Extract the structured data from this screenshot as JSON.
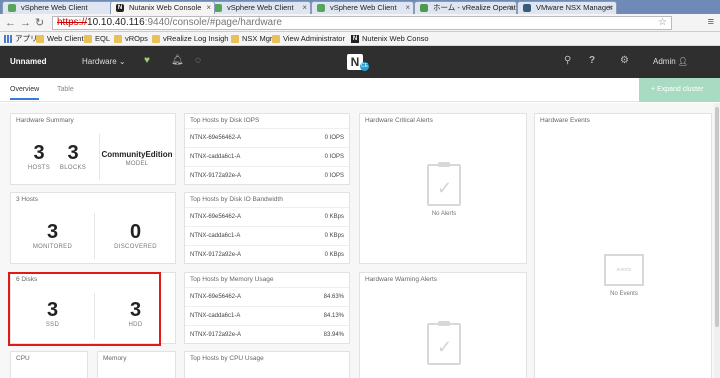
{
  "browser": {
    "tabs": [
      {
        "label": "vSphere Web Client",
        "icon": "vsphere-icon"
      },
      {
        "label": "Nutanix Web Console",
        "icon": "nutanix-icon"
      },
      {
        "label": "vSphere Web Client",
        "icon": "vsphere-icon"
      },
      {
        "label": "vSphere Web Client",
        "icon": "vsphere-icon"
      },
      {
        "label": "ホーム - vRealize Operat",
        "icon": "vrealize-icon"
      },
      {
        "label": "VMware NSX Manager",
        "icon": "vmware-icon"
      }
    ],
    "url_scheme": "https://",
    "url_host": "10.10.40.116",
    "url_path": ":9440/console/#page/hardware",
    "bookmarks": [
      "アプリ",
      "Web Client",
      "EQL",
      "vROps",
      "vRealize Log Insigh",
      "NSX Mgr",
      "View Administrator",
      "Nutenix Web Conso"
    ]
  },
  "header": {
    "cluster_name": "Unnamed",
    "menu": "Hardware",
    "logo_badge": "CE",
    "help": "?",
    "user": "Admin"
  },
  "subnav": {
    "tabs": [
      "Overview",
      "Table"
    ],
    "expand_button": "+ Expand cluster"
  },
  "hardware_summary": {
    "title": "Hardware Summary",
    "hosts_value": "3",
    "hosts_label": "HOSTS",
    "blocks_value": "3",
    "blocks_label": "BLOCKS",
    "model_value": "CommunityEdition",
    "model_label": "MODEL"
  },
  "hosts": {
    "title": "3 Hosts",
    "monitored_value": "3",
    "monitored_label": "MONITORED",
    "discovered_value": "0",
    "discovered_label": "DISCOVERED"
  },
  "disks": {
    "title": "6 Disks",
    "ssd_value": "3",
    "ssd_label": "SSD",
    "hdd_value": "3",
    "hdd_label": "HDD"
  },
  "cpu": {
    "title": "CPU"
  },
  "memory": {
    "title": "Memory"
  },
  "top_iops": {
    "title": "Top Hosts by Disk IOPS",
    "rows": [
      {
        "host": "NTNX-69e56462-A",
        "value": "0 IOPS"
      },
      {
        "host": "NTNX-cadda6c1-A",
        "value": "0 IOPS"
      },
      {
        "host": "NTNX-9172a92e-A",
        "value": "0 IOPS"
      }
    ]
  },
  "top_bw": {
    "title": "Top Hosts by Disk IO Bandwidth",
    "rows": [
      {
        "host": "NTNX-69e56462-A",
        "value": "0 KBps"
      },
      {
        "host": "NTNX-cadda6c1-A",
        "value": "0 KBps"
      },
      {
        "host": "NTNX-9172a92e-A",
        "value": "0 KBps"
      }
    ]
  },
  "top_mem": {
    "title": "Top Hosts by Memory Usage",
    "rows": [
      {
        "host": "NTNX-69e56462-A",
        "value": "84.63%"
      },
      {
        "host": "NTNX-cadda6c1-A",
        "value": "84.13%"
      },
      {
        "host": "NTNX-9172a92e-A",
        "value": "83.94%"
      }
    ]
  },
  "top_cpu": {
    "title": "Top Hosts by CPU Usage"
  },
  "critical_alerts": {
    "title": "Hardware Critical Alerts",
    "empty": "No Alerts"
  },
  "warning_alerts": {
    "title": "Hardware Warning Alerts"
  },
  "events": {
    "title": "Hardware Events",
    "empty": "No Events",
    "box_text": "events"
  },
  "colors": {
    "highlight": "#e01919",
    "accent": "#3a7bd5",
    "expand_button": "#a9dbc2",
    "header_bg": "#2f2f2f"
  }
}
